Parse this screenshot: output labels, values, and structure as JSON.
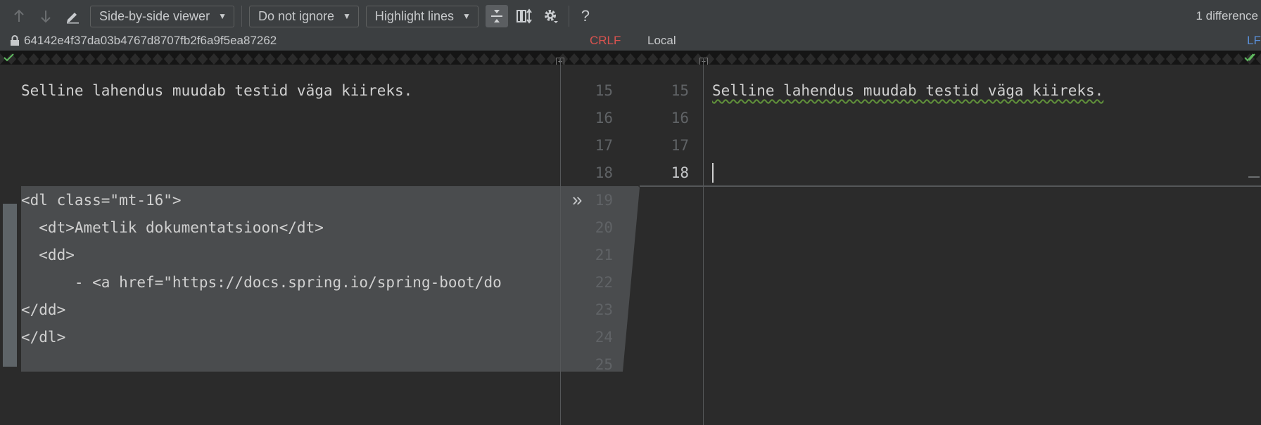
{
  "toolbar": {
    "viewer_dropdown": "Side-by-side viewer",
    "ignore_dropdown": "Do not ignore",
    "highlight_dropdown": "Highlight lines",
    "help_label": "?",
    "difference_count": "1 difference",
    "icons": [
      "arrow-up-icon",
      "arrow-down-icon",
      "edit-pencil-icon",
      "collapse-unchanged-icon",
      "sync-scroll-icon",
      "gear-icon",
      "help-icon"
    ]
  },
  "infobar": {
    "left_revision": "64142e4f37da03b4767d8707fb2f6a9f5ea87262",
    "left_line_ending": "CRLF",
    "right_label": "Local",
    "right_line_ending": "LF"
  },
  "left_pane": {
    "lines": [
      "Selline lahendus muudab testid väga kiireks.",
      "",
      "",
      "",
      "<dl class=\"mt-16\">",
      "  <dt>Ametlik dokumentatsioon</dt>",
      "  <dd>",
      "      - <a href=\"https://docs.spring.io/spring-boot/do",
      "</dd>",
      "</dl>",
      ""
    ]
  },
  "gutter": {
    "left_numbers": [
      "15",
      "16",
      "17",
      "18",
      "19",
      "20",
      "21",
      "22",
      "23",
      "24",
      "25"
    ],
    "right_numbers": [
      "15",
      "16",
      "17",
      "18"
    ],
    "apply_change_icon": "double-chevron-right-icon"
  },
  "right_pane": {
    "lines": [
      "Selline lahendus muudab testid väga kiireks.",
      "",
      "",
      ""
    ]
  },
  "colors": {
    "deleted_block": "#4a4c4e",
    "background": "#2b2b2b",
    "toolbar": "#3c3f41",
    "crlf": "#d9534f",
    "lf": "#5a8fd8"
  }
}
